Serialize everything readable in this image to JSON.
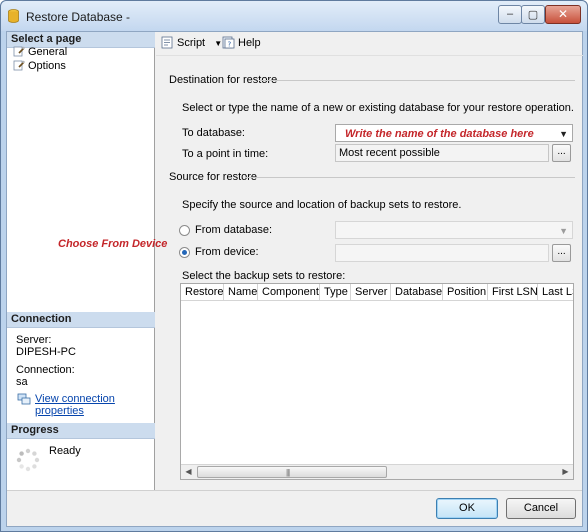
{
  "window": {
    "title": "Restore Database -",
    "controls": {
      "minimize": "–",
      "maximize": "▢",
      "close": "✕"
    }
  },
  "left_pane": {
    "select_page_header": "Select a page",
    "pages": [
      {
        "label": "General",
        "icon": "page-wrench-icon"
      },
      {
        "label": "Options",
        "icon": "page-wrench-icon"
      }
    ],
    "connection_header": "Connection",
    "server_label": "Server:",
    "server_value": "DIPESH-PC",
    "connection_label": "Connection:",
    "connection_value": "sa",
    "view_connection_link": "View connection properties",
    "progress_header": "Progress",
    "progress_status": "Ready"
  },
  "toolbar": {
    "script_label": "Script",
    "help_label": "Help"
  },
  "destination": {
    "group_title": "Destination for restore",
    "instruction": "Select or type the name of a new or existing database for your restore operation.",
    "to_database_label": "To database:",
    "to_database_value": "",
    "to_point_label": "To a point in time:",
    "to_point_value": "Most recent possible",
    "ellipsis": "..."
  },
  "source": {
    "group_title": "Source for restore",
    "instruction": "Specify the source and location of backup sets to restore.",
    "from_database_label": "From database:",
    "from_database_value": "",
    "from_device_label": "From device:",
    "from_device_value": "",
    "selected_option": "From device:",
    "ellipsis": "...",
    "backup_sets_label": "Select the backup sets to restore:"
  },
  "backup_grid": {
    "columns": [
      "Restore",
      "Name",
      "Component",
      "Type",
      "Server",
      "Database",
      "Position",
      "First LSN",
      "Last LS"
    ],
    "rows": [],
    "scroll_grip": "|||"
  },
  "annotations": {
    "database_name_hint": "Write the name of the database here",
    "choose_device_hint": "Choose From Device"
  },
  "buttons": {
    "ok": "OK",
    "cancel": "Cancel"
  },
  "colors": {
    "annotation_red": "#c4262a",
    "section_header_bg": "#ccdcee",
    "link_blue": "#0645ad",
    "radio_selected": "#2467b8"
  }
}
